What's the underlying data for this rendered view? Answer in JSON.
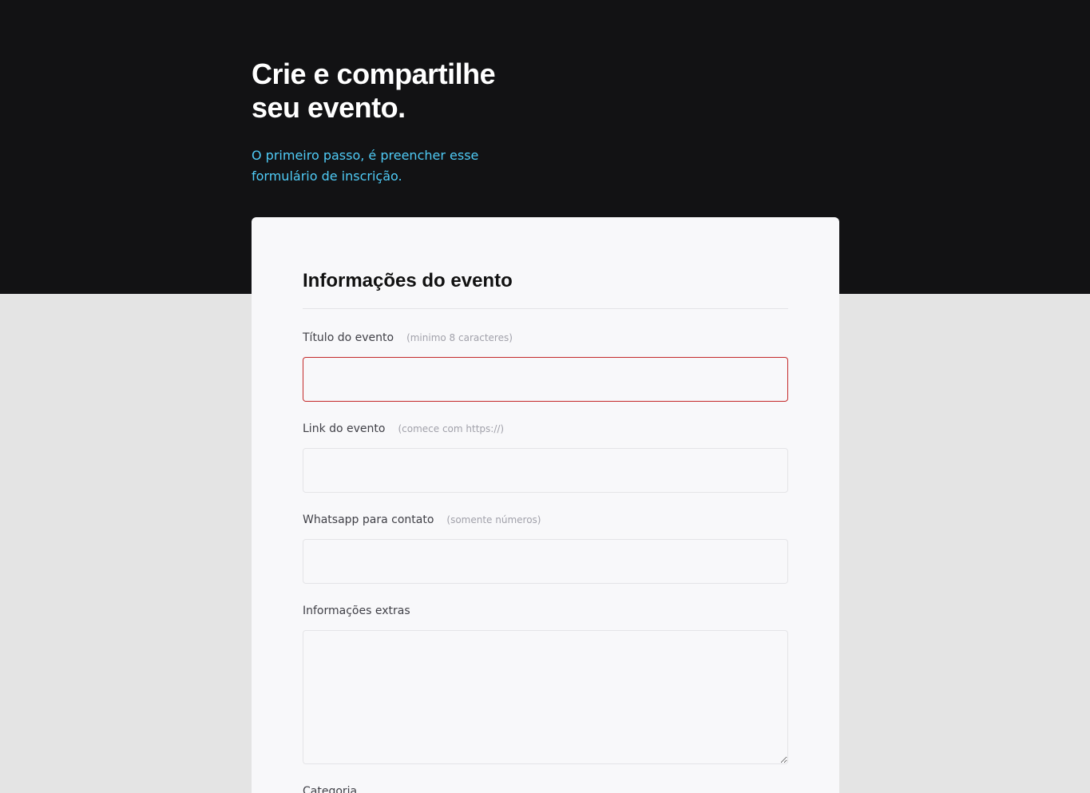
{
  "hero": {
    "title_line1": "Crie e compartilhe",
    "title_line2": "seu evento.",
    "subtitle_line1": "O primeiro passo, é preencher esse",
    "subtitle_line2": "formulário de inscrição."
  },
  "form": {
    "section_title": "Informações do evento",
    "fields": [
      {
        "label": "Título do evento",
        "hint": "(minimo 8 caracteres)",
        "value": ""
      },
      {
        "label": "Link do evento",
        "hint": "(comece com https://)",
        "value": ""
      },
      {
        "label": "Whatsapp para contato",
        "hint": "(somente números)",
        "value": ""
      },
      {
        "label": "Informações extras",
        "hint": "",
        "value": ""
      },
      {
        "label": "Categoria",
        "hint": ""
      }
    ]
  },
  "colors": {
    "hero_background": "#121214",
    "page_background": "#e4e4e4",
    "accent": "#4fcbf6",
    "error_border": "#c42a2a",
    "card_background": "#f8f8fa"
  }
}
